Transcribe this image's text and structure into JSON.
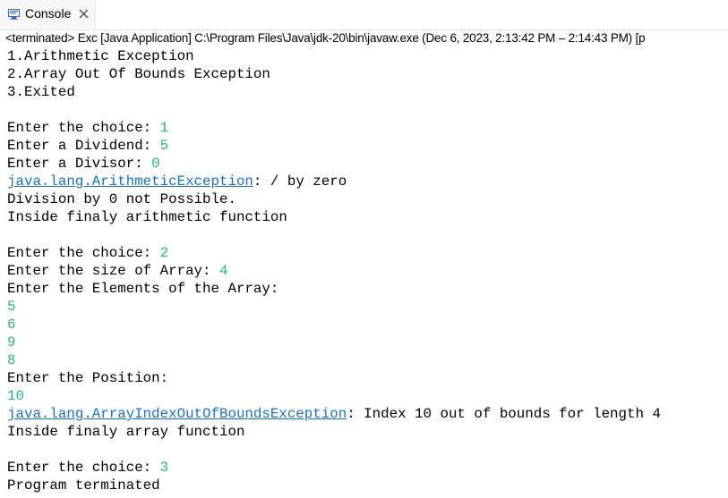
{
  "tab": {
    "label": "Console",
    "icon": "console-icon",
    "close_icon": "close-icon"
  },
  "status": {
    "text": "<terminated> Exc [Java Application] C:\\Program Files\\Java\\jdk-20\\bin\\javaw.exe  (Dec 6, 2023, 2:13:42 PM – 2:14:43 PM) [p"
  },
  "colors": {
    "input_text": "#2cb27b",
    "link": "#1f6fbf",
    "output_text": "#000000"
  },
  "console": {
    "menu1": "1.Arithmetic Exception",
    "menu2": "2.Array Out Of Bounds Exception",
    "menu3": "3.Exited",
    "prompt_choice_1": "Enter the choice: ",
    "input_choice_1": "1",
    "prompt_dividend": "Enter a Dividend: ",
    "input_dividend": "5",
    "prompt_divisor": "Enter a Divisor: ",
    "input_divisor": "0",
    "exception_1_class": "java.lang.ArithmeticException",
    "exception_1_msg": ": / by zero",
    "division_msg": "Division by 0 not Possible.",
    "finally_arith": "Inside finaly arithmetic function",
    "prompt_choice_2": "Enter the choice: ",
    "input_choice_2": "2",
    "prompt_size": "Enter the size of Array: ",
    "input_size": "4",
    "prompt_elements": "Enter the Elements of the Array:",
    "element_1": "5",
    "element_2": "6",
    "element_3": "9",
    "element_4": "8",
    "prompt_position": "Enter the Position:",
    "input_position": "10",
    "exception_2_class": "java.lang.ArrayIndexOutOfBoundsException",
    "exception_2_msg": ": Index 10 out of bounds for length 4",
    "finally_array": "Inside finaly array function",
    "prompt_choice_3": "Enter the choice: ",
    "input_choice_3": "3",
    "terminated_msg": "Program terminated"
  }
}
